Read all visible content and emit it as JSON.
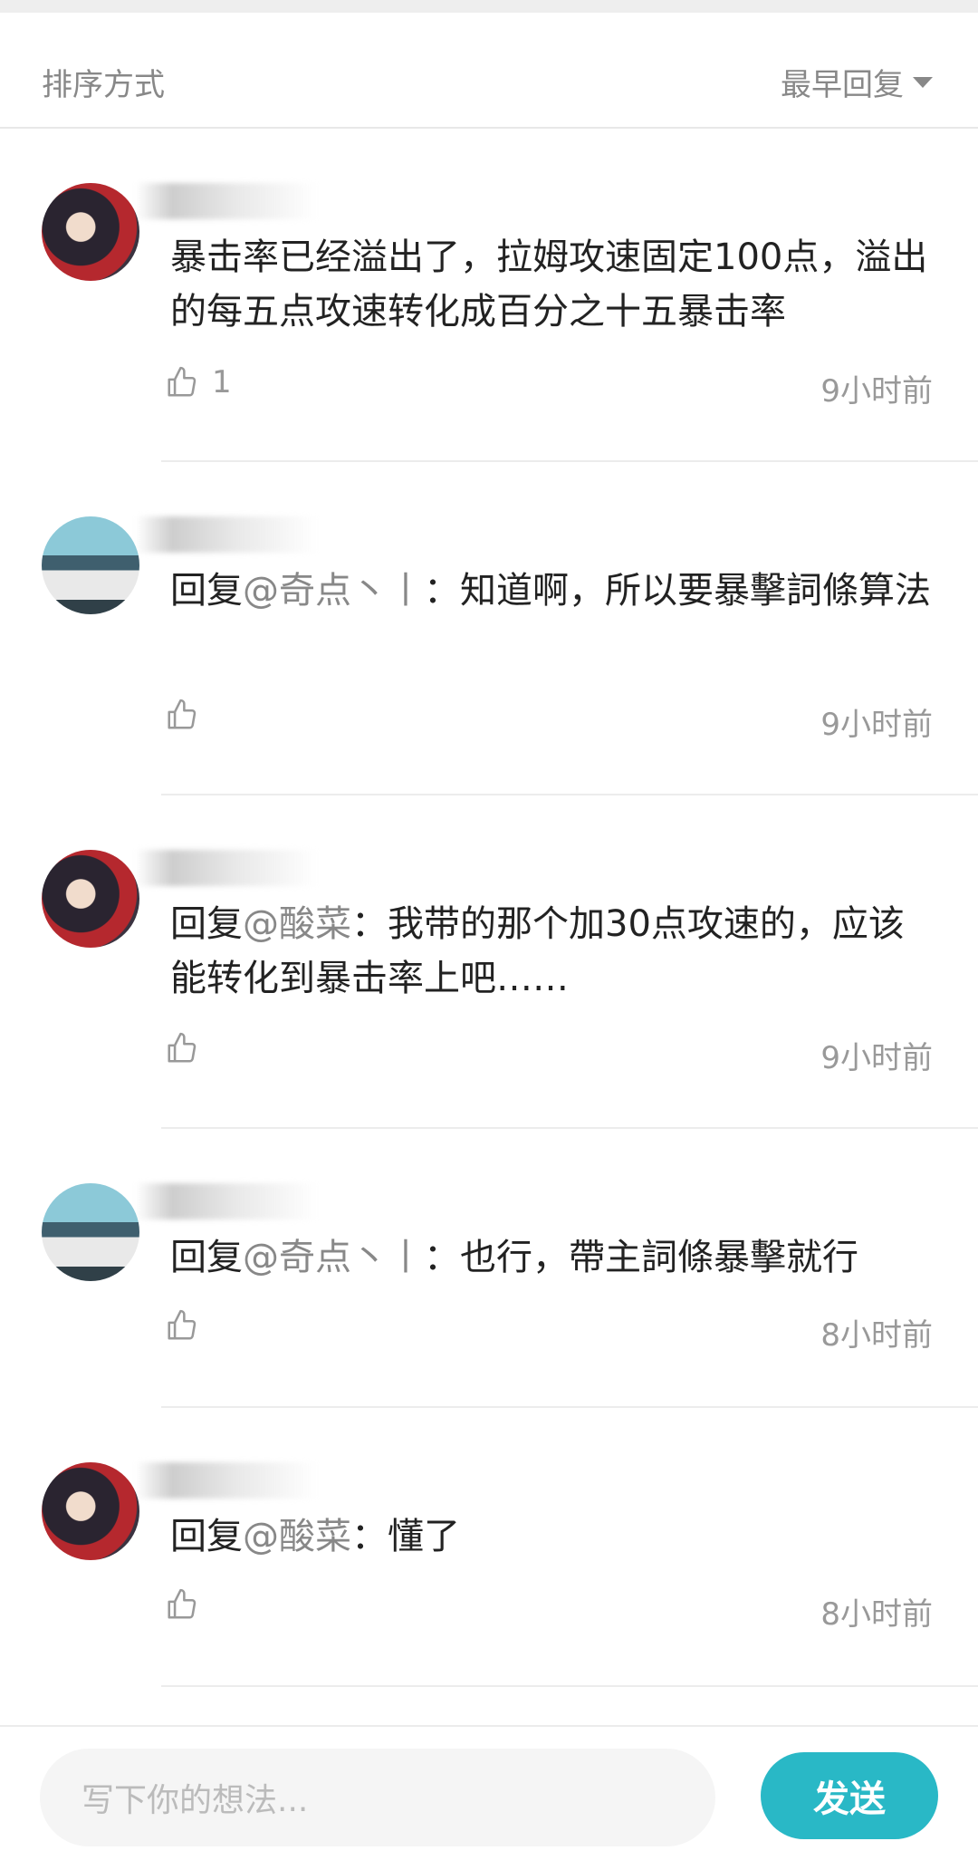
{
  "sort": {
    "label": "排序方式",
    "selected": "最早回复"
  },
  "comments": [
    {
      "avatar": "avatar-dark-hair-red",
      "text": "暴击率已经溢出了，拉姆攻速固定100点，溢出的每五点攻速转化成百分之十五暴击率",
      "likes": "1",
      "time": "9小时前"
    },
    {
      "avatar": "avatar-two-people",
      "reply_prefix": "回复",
      "mention": "@奇点丶丨",
      "text": "：知道啊，所以要暴擊詞條算法",
      "time": "9小时前"
    },
    {
      "avatar": "avatar-dark-hair-red",
      "reply_prefix": "回复",
      "mention": "@酸菜",
      "text": "：我带的那个加30点攻速的，应该能转化到暴击率上吧……",
      "time": "9小时前"
    },
    {
      "avatar": "avatar-two-people",
      "reply_prefix": "回复",
      "mention": "@奇点丶丨",
      "text": "：也行，帶主詞條暴擊就行",
      "time": "8小时前"
    },
    {
      "avatar": "avatar-dark-hair-red",
      "reply_prefix": "回复",
      "mention": "@酸菜",
      "text": "：懂了",
      "time": "8小时前"
    }
  ],
  "input": {
    "placeholder": "写下你的想法..."
  },
  "send_label": "发送",
  "colors": {
    "accent": "#29b8c6",
    "muted": "#888888"
  }
}
